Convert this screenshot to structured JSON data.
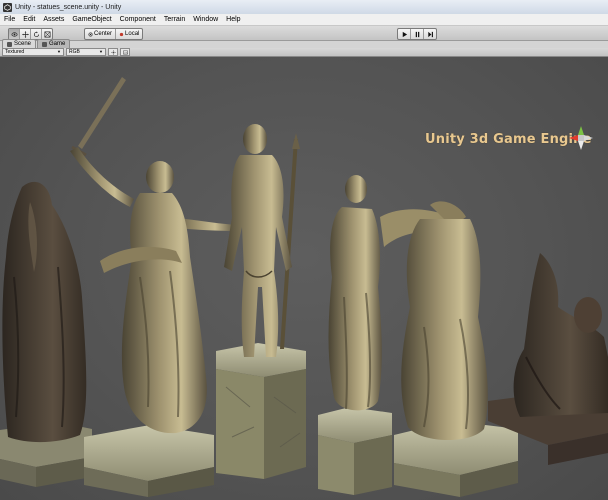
{
  "window": {
    "title": "Unity - statues_scene.unity - Unity",
    "icon": "unity-logo-icon"
  },
  "menu": {
    "items": [
      "File",
      "Edit",
      "Assets",
      "GameObject",
      "Component",
      "Terrain",
      "Window",
      "Help"
    ]
  },
  "toolbar": {
    "tools": [
      "hand-icon",
      "move-icon",
      "rotate-icon",
      "scale-icon"
    ],
    "active_tool": "hand-icon",
    "pivot_mode_label": "Center",
    "pivot_rotation_label": "Local",
    "playback": [
      "play-icon",
      "pause-icon",
      "step-icon"
    ]
  },
  "tabs": [
    {
      "label": "Scene",
      "active": true
    },
    {
      "label": "Game",
      "active": false
    }
  ],
  "scene_view": {
    "render_mode": "Textured",
    "color_mode": "RGB",
    "background_color": "#585858",
    "watermark_text": "Unity 3d Game Engine",
    "gizmo": "scene-orientation-gizmo",
    "objects": [
      "bearded-robed-statue",
      "sword-wielding-winged-victory-statue",
      "nude-male-spear-statue",
      "draped-female-statue",
      "headless-winged-victory-statue",
      "sphinx-statue"
    ]
  }
}
